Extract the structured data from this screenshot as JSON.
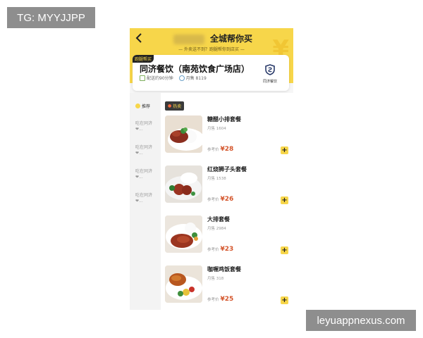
{
  "watermarks": {
    "top_left": "TG: MYYJJPP",
    "bottom_right": "leyuappnexus.com"
  },
  "header": {
    "back_icon": "chevron-left-icon",
    "title": "全城帮你买",
    "subtitle": "— 外卖送不到？跑腿帮你到店买 —",
    "accent_color": "#f7d64a"
  },
  "store": {
    "tag": "跑腿帮买",
    "name": "同济餐饮（南苑饮食广场店）",
    "delivery": "配送约90分钟",
    "monthly_sales": "月售 8119",
    "logo_text": "同济餐饮"
  },
  "sidebar": {
    "recommend": "推荐",
    "items": [
      "吃在同济❤...",
      "吃在同济❤...",
      "吃在同济❤...",
      "吃在同济❤..."
    ]
  },
  "hot_label": "热卖",
  "products": [
    {
      "name": "糖醋小排套餐",
      "sales": "月售 1604",
      "price_label": "参考价",
      "price": "¥28",
      "dish": "ribs"
    },
    {
      "name": "红烧狮子头套餐",
      "sales": "月售 1538",
      "price_label": "参考价",
      "price": "¥26",
      "dish": "meatballs"
    },
    {
      "name": "大排套餐",
      "sales": "月售 2984",
      "price_label": "参考价",
      "price": "¥23",
      "dish": "pork-chop"
    },
    {
      "name": "咖喱鸡饭套餐",
      "sales": "月售 318",
      "price_label": "参考价",
      "price": "¥25",
      "dish": "curry-chicken"
    }
  ],
  "add_label": "+"
}
